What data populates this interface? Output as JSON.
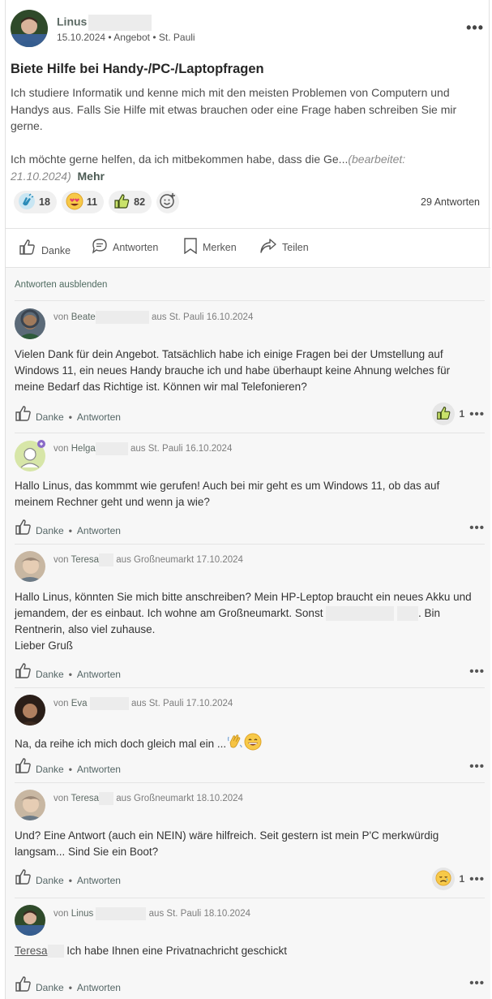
{
  "post": {
    "author_name": "Linus",
    "date": "15.10.2024",
    "category": "Angebot",
    "location": "St. Pauli",
    "title": "Biete Hilfe bei Handy-/PC-/Laptopfragen",
    "paragraph1": "Ich studiere Informatik und kenne mich mit den meisten Problemen von Computern und Handys aus. Falls Sie Hilfe mit etwas brauchen oder eine Frage haben schreiben Sie mir gerne.",
    "paragraph2": "Ich möchte gerne helfen, da ich mitbekommen habe, dass die Ge...",
    "edited_note": "(bearbeitet: 21.10.2024)",
    "more_label": "Mehr",
    "reactions": [
      {
        "icon": "clapping-hands-icon",
        "count": "18"
      },
      {
        "icon": "heart-eyes-icon",
        "count": "11"
      },
      {
        "icon": "thumbs-up-icon",
        "count": "82"
      }
    ],
    "answers_count_label": "29 Antworten"
  },
  "actions": {
    "thanks": "Danke",
    "reply": "Antworten",
    "bookmark": "Merken",
    "share": "Teilen"
  },
  "comments_section": {
    "hide_label": "Antworten ausblenden"
  },
  "comment_labels": {
    "from": "von",
    "from_place": "aus",
    "thanks": "Danke",
    "reply": "Antworten",
    "dot": "•"
  },
  "comments": [
    {
      "author": "Beate",
      "location": "St. Pauli",
      "date": "16.10.2024",
      "text": "Vielen Dank für dein Angebot. Tatsächlich habe ich einige Fragen bei der Umstellung auf Windows 11, ein neues Handy brauche ich und habe überhaupt keine Ahnung welches für meine Bedarf das Richtige ist. Können wir mal Telefonieren?",
      "reaction_count": "1"
    },
    {
      "author": "Helga",
      "location": "St. Pauli",
      "date": "16.10.2024",
      "text": "Hallo Linus, das kommmt wie gerufen! Auch bei mir geht es um Windows 11, ob das auf meinem Rechner geht und wenn ja wie?"
    },
    {
      "author": "Teresa",
      "location": "Großneumarkt",
      "date": "17.10.2024",
      "text_a": "Hallo Linus, könnten Sie mich bitte anschreiben? Mein HP-Leptop braucht ein neues Akku und jemandem, der es einbaut. Ich wohne am Großneumarkt. Sonst",
      "text_b": ". Bin Rentnerin, also viel zuhause.",
      "text_c": "Lieber Gruß"
    },
    {
      "author": "Eva",
      "location": "St. Pauli",
      "date": "17.10.2024",
      "text": "Na, da reihe ich mich doch gleich mal ein ..."
    },
    {
      "author": "Teresa",
      "location": "Großneumarkt",
      "date": "18.10.2024",
      "text": "Und? Eine Antwort (auch ein NEIN) wäre hilfreich. Seit gestern ist mein P'C merkwürdig langsam... Sind Sie ein Boot?",
      "reaction_count": "1"
    },
    {
      "author": "Linus",
      "location": "St. Pauli",
      "date": "18.10.2024",
      "mention": "Teresa",
      "text": " Ich habe Ihnen eine Privatnachricht geschickt"
    }
  ],
  "colors": {
    "accent": "#4f6b60",
    "thumb_green": "#8bab1e"
  }
}
